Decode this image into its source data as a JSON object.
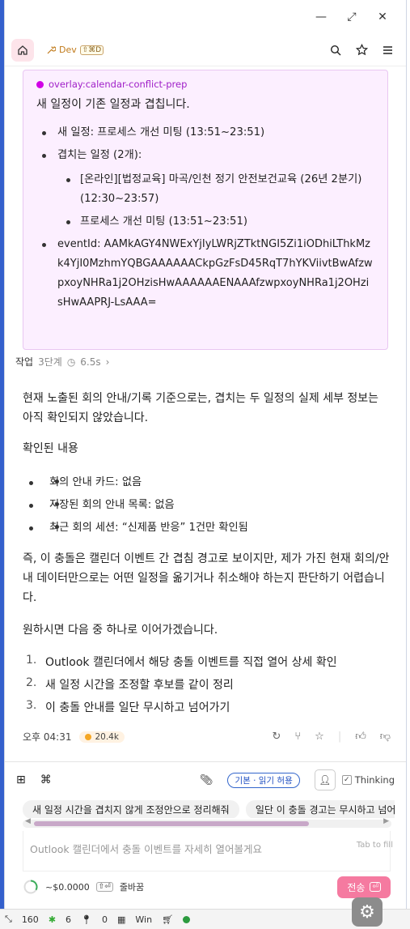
{
  "window": {
    "expand_icon": "⤢",
    "close_icon": "✕",
    "minimize_icon": "—"
  },
  "header": {
    "dev_label": "Dev",
    "dev_shortcut": "⇧⌘D"
  },
  "overlay": {
    "tag": "overlay:calendar-conflict-prep",
    "title": "새 일정이 기존 일정과 겹칩니다.",
    "new_event": "새 일정: 프로세스 개선 미팅 (13:51~23:51)",
    "overlap_label": "겹치는 일정 (2개):",
    "overlaps": [
      "[온라인][법정교육] 마곡/인천 정기 안전보건교육 (26년 2분기) (12:30~23:57)",
      "프로세스 개선 미팅 (13:51~23:51)"
    ],
    "event_id": "eventId: AAMkAGY4NWExYjIyLWRjZTktNGI5Zi1iODhiLThkMzk4YjI0MzhmYQBGAAAAAACkpGzFsD45RqT7hYKViivtBwAfzwpxoyNHRa1j2OHzisHwAAAAAAENAAAfzwpxoyNHRa1j2OHzisHwAAPRJ-LsAAA="
  },
  "steps": {
    "label": "작업",
    "count": "3단계",
    "time": "6.5s"
  },
  "message": {
    "p1": "현재 노출된 회의 안내/기록 기준으로는, 겹치는 두 일정의 실제 세부 정보는 아직 확인되지 않았습니다.",
    "confirmed_title": "확인된 내용",
    "confirmed": [
      "회의 안내 카드: 없음",
      "저장된 회의 안내 목록: 없음",
      "최근 회의 세션: “신제품 반응” 1건만 확인됨"
    ],
    "p2": "즉, 이 충돌은 캘린더 이벤트 간 겹침 경고로 보이지만, 제가 가진 현재 회의/안내 데이터만으로는 어떤 일정을 옮기거나 취소해야 하는지 판단하기 어렵습니다.",
    "p3": "원하시면 다음 중 하나로 이어가겠습니다.",
    "options": [
      {
        "n": "1.",
        "t": "Outlook 캘린더에서 해당 충돌 이벤트를 직접 열어 상세 확인"
      },
      {
        "n": "2.",
        "t": "새 일정 시간을 조정할 후보를 같이 정리"
      },
      {
        "n": "3.",
        "t": "이 충돌 안내를 일단 무시하고 넘어가기"
      }
    ],
    "time": "오후 04:31",
    "tokens": "20.4k"
  },
  "composer": {
    "mode_pill": "기본 · 읽기 허용",
    "thinking": "Thinking",
    "suggestions": [
      "새 일정 시간을 겹치지 않게 조정안으로 정리해줘",
      "일단 이 충돌 경고는 무시하고 넘어가"
    ],
    "placeholder": "Outlook 캘린더에서 충돌 이벤트를 자세히 열어볼게요",
    "tab_hint": "Tab to fill",
    "cost": "~$0.0000",
    "wrap_key": "⇧⏎",
    "wrap_label": "줄바꿈",
    "send": "전송"
  },
  "statusbar": {
    "count1": "160",
    "count2": "6",
    "count3": "0",
    "platform": "Win"
  }
}
